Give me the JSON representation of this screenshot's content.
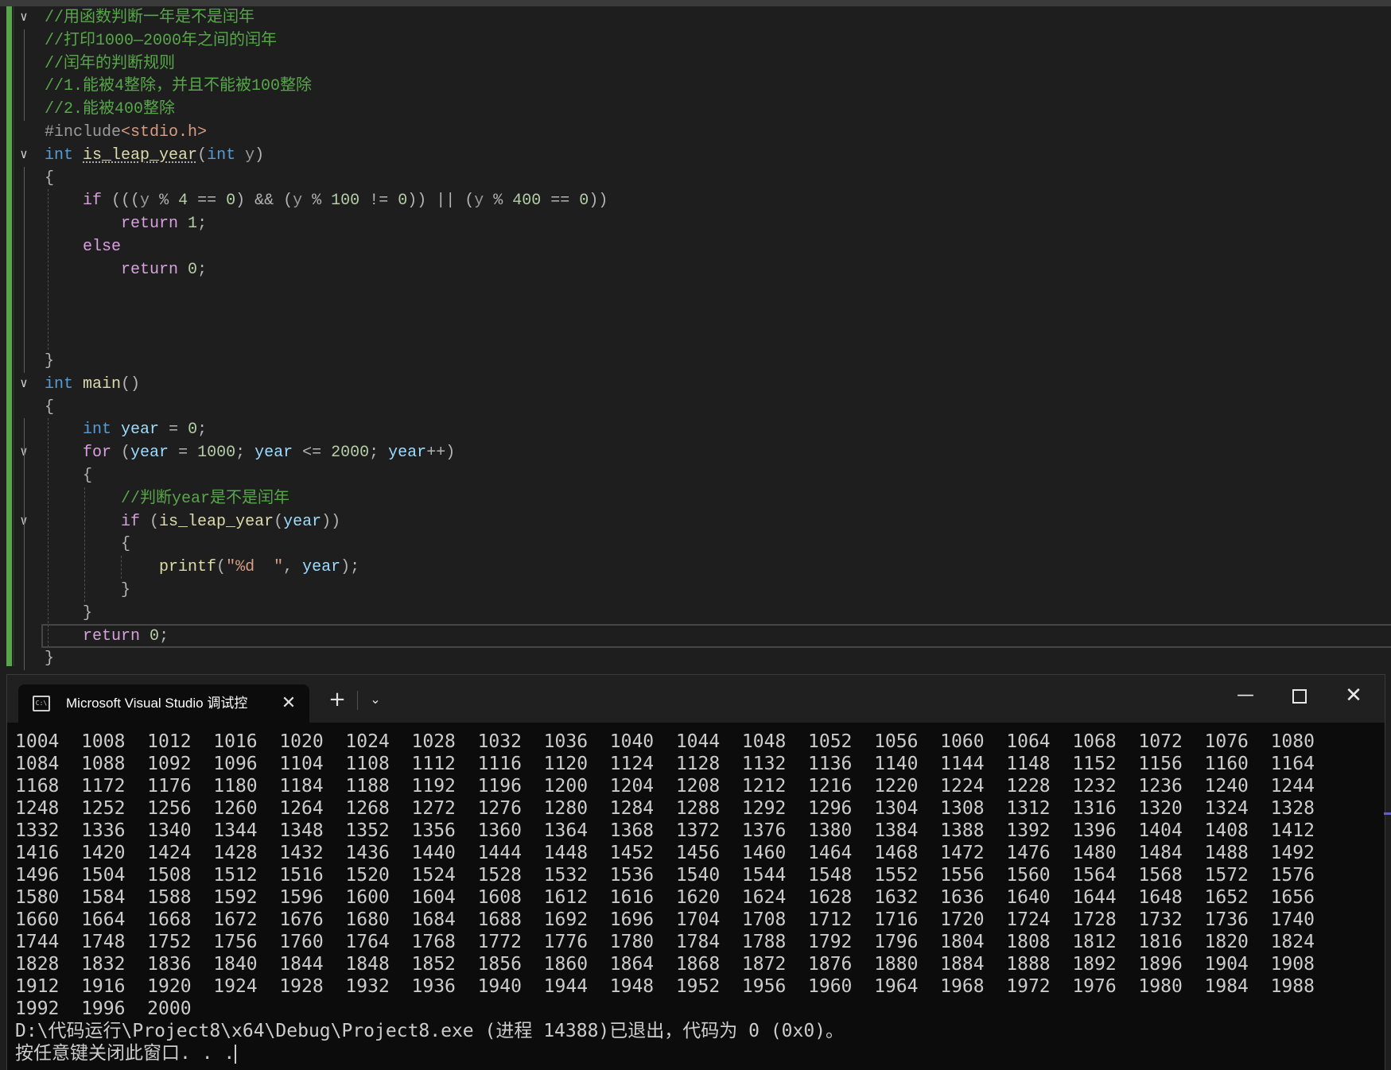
{
  "editor": {
    "lines": [
      {
        "fold": "v",
        "tokens": [
          {
            "t": "//用函数判断一年是不是闰年",
            "c": "comment"
          }
        ]
      },
      {
        "fold": "",
        "tokens": [
          {
            "t": "//打印1000—2000年之间的闰年",
            "c": "comment"
          }
        ]
      },
      {
        "fold": "",
        "tokens": [
          {
            "t": "//闰年的判断规则",
            "c": "comment"
          }
        ]
      },
      {
        "fold": "",
        "tokens": [
          {
            "t": "//1.能被4整除，并且不能被100整除",
            "c": "comment"
          }
        ]
      },
      {
        "fold": "",
        "tokens": [
          {
            "t": "//2.能被400整除",
            "c": "comment"
          }
        ]
      },
      {
        "fold": "",
        "tokens": [
          {
            "t": "#include",
            "c": "pre"
          },
          {
            "t": "<stdio.h>",
            "c": "inc"
          }
        ]
      },
      {
        "fold": "v",
        "tokens": [
          {
            "t": "int",
            "c": "kw"
          },
          {
            "t": " ",
            "c": "op"
          },
          {
            "t": "is_leap_year",
            "c": "fn",
            "squiggle": true
          },
          {
            "t": "(",
            "c": "op"
          },
          {
            "t": "int",
            "c": "kw"
          },
          {
            "t": " ",
            "c": "op"
          },
          {
            "t": "y",
            "c": "param"
          },
          {
            "t": ")",
            "c": "op"
          }
        ]
      },
      {
        "fold": "",
        "tokens": [
          {
            "t": "{",
            "c": "op"
          }
        ]
      },
      {
        "fold": "",
        "tokens": [
          {
            "t": "    ",
            "c": "op"
          },
          {
            "t": "if",
            "c": "ctrl"
          },
          {
            "t": " (((",
            "c": "op"
          },
          {
            "t": "y",
            "c": "param"
          },
          {
            "t": " % ",
            "c": "op"
          },
          {
            "t": "4",
            "c": "num"
          },
          {
            "t": " == ",
            "c": "op"
          },
          {
            "t": "0",
            "c": "num"
          },
          {
            "t": ") && (",
            "c": "op"
          },
          {
            "t": "y",
            "c": "param"
          },
          {
            "t": " % ",
            "c": "op"
          },
          {
            "t": "100",
            "c": "num"
          },
          {
            "t": " != ",
            "c": "op"
          },
          {
            "t": "0",
            "c": "num"
          },
          {
            "t": ")) || (",
            "c": "op"
          },
          {
            "t": "y",
            "c": "param"
          },
          {
            "t": " % ",
            "c": "op"
          },
          {
            "t": "400",
            "c": "num"
          },
          {
            "t": " == ",
            "c": "op"
          },
          {
            "t": "0",
            "c": "num"
          },
          {
            "t": "))",
            "c": "op"
          }
        ]
      },
      {
        "fold": "",
        "tokens": [
          {
            "t": "        ",
            "c": "op"
          },
          {
            "t": "return",
            "c": "ctrl"
          },
          {
            "t": " ",
            "c": "op"
          },
          {
            "t": "1",
            "c": "num"
          },
          {
            "t": ";",
            "c": "op"
          }
        ]
      },
      {
        "fold": "",
        "tokens": [
          {
            "t": "    ",
            "c": "op"
          },
          {
            "t": "else",
            "c": "ctrl"
          }
        ]
      },
      {
        "fold": "",
        "tokens": [
          {
            "t": "        ",
            "c": "op"
          },
          {
            "t": "return",
            "c": "ctrl"
          },
          {
            "t": " ",
            "c": "op"
          },
          {
            "t": "0",
            "c": "num"
          },
          {
            "t": ";",
            "c": "op"
          }
        ]
      },
      {
        "fold": "",
        "tokens": []
      },
      {
        "fold": "",
        "tokens": []
      },
      {
        "fold": "",
        "tokens": []
      },
      {
        "fold": "",
        "tokens": [
          {
            "t": "}",
            "c": "op"
          }
        ]
      },
      {
        "fold": "v",
        "tokens": [
          {
            "t": "int",
            "c": "kw"
          },
          {
            "t": " ",
            "c": "op"
          },
          {
            "t": "main",
            "c": "fn"
          },
          {
            "t": "()",
            "c": "op"
          }
        ]
      },
      {
        "fold": "",
        "tokens": [
          {
            "t": "{",
            "c": "op"
          }
        ]
      },
      {
        "fold": "",
        "tokens": [
          {
            "t": "    ",
            "c": "op"
          },
          {
            "t": "int",
            "c": "kw"
          },
          {
            "t": " ",
            "c": "op"
          },
          {
            "t": "year",
            "c": "var"
          },
          {
            "t": " = ",
            "c": "op"
          },
          {
            "t": "0",
            "c": "num"
          },
          {
            "t": ";",
            "c": "op"
          }
        ]
      },
      {
        "fold": "v",
        "tokens": [
          {
            "t": "    ",
            "c": "op"
          },
          {
            "t": "for",
            "c": "ctrl"
          },
          {
            "t": " (",
            "c": "op"
          },
          {
            "t": "year",
            "c": "var"
          },
          {
            "t": " = ",
            "c": "op"
          },
          {
            "t": "1000",
            "c": "num"
          },
          {
            "t": "; ",
            "c": "op"
          },
          {
            "t": "year",
            "c": "var"
          },
          {
            "t": " <= ",
            "c": "op"
          },
          {
            "t": "2000",
            "c": "num"
          },
          {
            "t": "; ",
            "c": "op"
          },
          {
            "t": "year",
            "c": "var"
          },
          {
            "t": "++)",
            "c": "op"
          }
        ]
      },
      {
        "fold": "",
        "tokens": [
          {
            "t": "    {",
            "c": "op"
          }
        ]
      },
      {
        "fold": "",
        "tokens": [
          {
            "t": "        ",
            "c": "op"
          },
          {
            "t": "//判断year是不是闰年",
            "c": "comment"
          }
        ]
      },
      {
        "fold": "v",
        "tokens": [
          {
            "t": "        ",
            "c": "op"
          },
          {
            "t": "if",
            "c": "ctrl"
          },
          {
            "t": " (",
            "c": "op"
          },
          {
            "t": "is_leap_year",
            "c": "fn"
          },
          {
            "t": "(",
            "c": "op"
          },
          {
            "t": "year",
            "c": "var"
          },
          {
            "t": "))",
            "c": "op"
          }
        ]
      },
      {
        "fold": "",
        "tokens": [
          {
            "t": "        {",
            "c": "op"
          }
        ]
      },
      {
        "fold": "",
        "tokens": [
          {
            "t": "            ",
            "c": "op"
          },
          {
            "t": "printf",
            "c": "fn"
          },
          {
            "t": "(",
            "c": "op"
          },
          {
            "t": "\"%d  \"",
            "c": "str"
          },
          {
            "t": ", ",
            "c": "op"
          },
          {
            "t": "year",
            "c": "var"
          },
          {
            "t": ");",
            "c": "op"
          }
        ]
      },
      {
        "fold": "",
        "tokens": [
          {
            "t": "        }",
            "c": "op"
          }
        ]
      },
      {
        "fold": "",
        "tokens": [
          {
            "t": "    }",
            "c": "op"
          }
        ]
      },
      {
        "fold": "",
        "tokens": [
          {
            "t": "    ",
            "c": "op"
          },
          {
            "t": "return",
            "c": "ctrl"
          },
          {
            "t": " ",
            "c": "op"
          },
          {
            "t": "0",
            "c": "num"
          },
          {
            "t": ";",
            "c": "op"
          }
        ]
      },
      {
        "fold": "",
        "tokens": [
          {
            "t": "}",
            "c": "op"
          }
        ]
      }
    ]
  },
  "console": {
    "tab_title": "Microsoft Visual Studio 调试控",
    "tab_icon_glyph": "C:\\",
    "close_tab_glyph": "✕",
    "new_tab_glyph": "+",
    "dropdown_glyph": "⌄",
    "minimize_glyph": "—",
    "close_window_glyph": "✕",
    "output_rows": [
      "1004  1008  1012  1016  1020  1024  1028  1032  1036  1040  1044  1048  1052  1056  1060  1064  1068  1072  1076  1080",
      "1084  1088  1092  1096  1104  1108  1112  1116  1120  1124  1128  1132  1136  1140  1144  1148  1152  1156  1160  1164",
      "1168  1172  1176  1180  1184  1188  1192  1196  1200  1204  1208  1212  1216  1220  1224  1228  1232  1236  1240  1244",
      "1248  1252  1256  1260  1264  1268  1272  1276  1280  1284  1288  1292  1296  1304  1308  1312  1316  1320  1324  1328",
      "1332  1336  1340  1344  1348  1352  1356  1360  1364  1368  1372  1376  1380  1384  1388  1392  1396  1404  1408  1412",
      "1416  1420  1424  1428  1432  1436  1440  1444  1448  1452  1456  1460  1464  1468  1472  1476  1480  1484  1488  1492",
      "1496  1504  1508  1512  1516  1520  1524  1528  1532  1536  1540  1544  1548  1552  1556  1560  1564  1568  1572  1576",
      "1580  1584  1588  1592  1596  1600  1604  1608  1612  1616  1620  1624  1628  1632  1636  1640  1644  1648  1652  1656",
      "1660  1664  1668  1672  1676  1680  1684  1688  1692  1696  1704  1708  1712  1716  1720  1724  1728  1732  1736  1740",
      "1744  1748  1752  1756  1760  1764  1768  1772  1776  1780  1784  1788  1792  1796  1804  1808  1812  1816  1820  1824",
      "1828  1832  1836  1840  1844  1848  1852  1856  1860  1864  1868  1872  1876  1880  1884  1888  1892  1896  1904  1908",
      "1912  1916  1920  1924  1928  1932  1936  1940  1944  1948  1952  1956  1960  1964  1968  1972  1976  1980  1984  1988",
      "1992  1996  2000",
      "D:\\代码运行\\Project8\\x64\\Debug\\Project8.exe (进程 14388)已退出，代码为 0 (0x0)。",
      "按任意键关闭此窗口. . ."
    ]
  }
}
